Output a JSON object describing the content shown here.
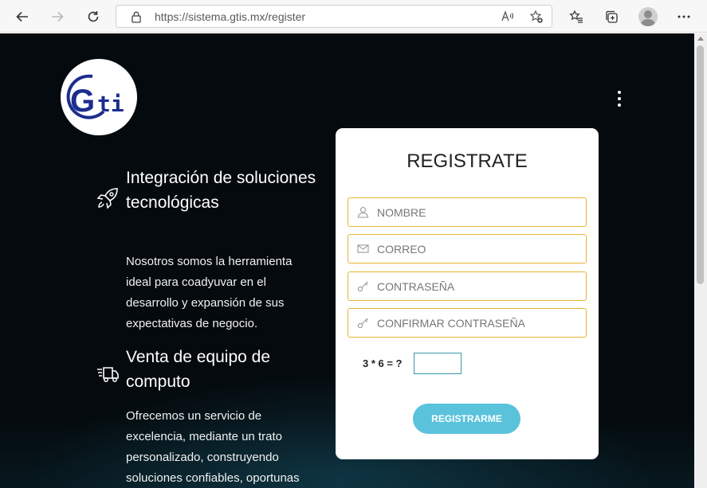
{
  "browser": {
    "url": "https://sistema.gtis.mx/register",
    "icons": [
      "back-icon",
      "forward-icon",
      "reload-icon",
      "lock-icon",
      "read-aloud-icon",
      "add-favorite-icon",
      "favorites-icon",
      "collections-icon",
      "profile-icon",
      "more-icon"
    ]
  },
  "page": {
    "logo_text": "Gti",
    "features": [
      {
        "icon": "rocket-icon",
        "title": "Integración de soluciones tecnológicas",
        "text": "Nosotros somos la herramienta ideal para coadyuvar en el desarrollo y expansión de sus expectativas de negocio."
      },
      {
        "icon": "delivery-truck-icon",
        "title": "Venta de equipo de computo",
        "text": "Ofrecemos un servicio de excelencia, mediante un trato personalizado, construyendo soluciones confiables, oportunas"
      }
    ]
  },
  "form": {
    "title": "REGISTRATE",
    "fields": {
      "name": {
        "placeholder": "NOMBRE",
        "icon": "user-icon"
      },
      "email": {
        "placeholder": "CORREO",
        "icon": "envelope-icon"
      },
      "password": {
        "placeholder": "CONTRASEÑA",
        "icon": "key-icon"
      },
      "confirm": {
        "placeholder": "CONFIRMAR CONTRASEÑA",
        "icon": "key-icon"
      }
    },
    "captcha_question": "3 * 6 = ?",
    "submit_label": "REGISTRARME"
  },
  "colors": {
    "input_border": "#e6b632",
    "button": "#5bc2dc",
    "background": "#05090b"
  }
}
